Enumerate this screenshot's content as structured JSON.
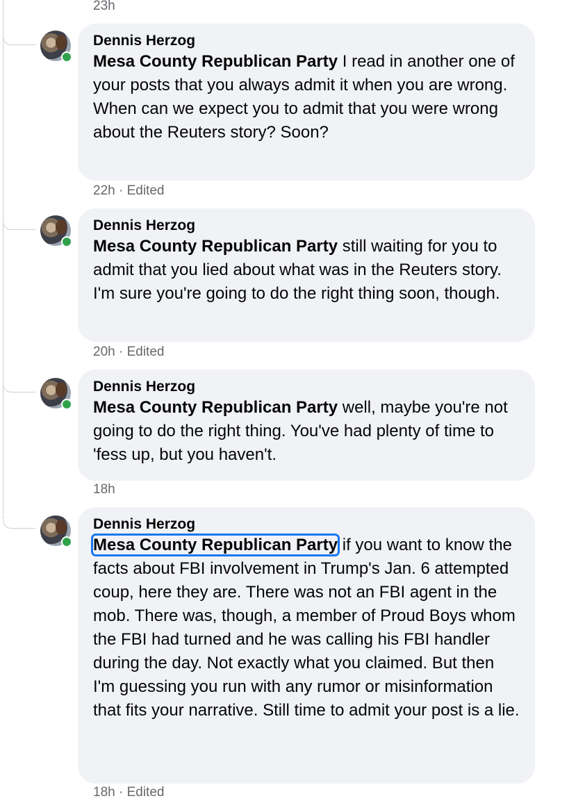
{
  "thread": {
    "top_timestamp": "23h",
    "comments": [
      {
        "author": "Dennis Herzog",
        "mention": "Mesa County Republican Party",
        "text": " I read in another one of your posts that you always admit it when you are wrong. When can we expect you to admit that you were wrong about the Reuters story? Soon?",
        "meta": "22h · Edited"
      },
      {
        "author": "Dennis Herzog",
        "mention": "Mesa County Republican Party",
        "text": " still waiting for you to admit that you lied about what was in the Reuters story. I'm sure you're going to do the right thing soon, though.",
        "meta": "20h · Edited"
      },
      {
        "author": "Dennis Herzog",
        "mention": "Mesa County Republican Party",
        "text": " well, maybe you're not going to do the right thing. You've had plenty of time to 'fess up, but you haven't.",
        "meta": "18h"
      },
      {
        "author": "Dennis Herzog",
        "mention": "Mesa County Republican Party",
        "text": " if you want to know the facts about FBI involvement in Trump's Jan. 6 attempted coup, here they are. There was not an FBI agent in the mob. There was, though, a member of Proud Boys whom the FBI had turned and he was calling his FBI handler during the day. Not exactly what you claimed. But then I'm guessing you run with any rumor or misinformation that fits your narrative. Still time to admit your post is a lie.",
        "meta": "18h · Edited"
      }
    ]
  },
  "colors": {
    "bubble": "#f0f2f5",
    "online": "#31a24c",
    "focus": "#1877f2",
    "meta": "#65676b"
  }
}
